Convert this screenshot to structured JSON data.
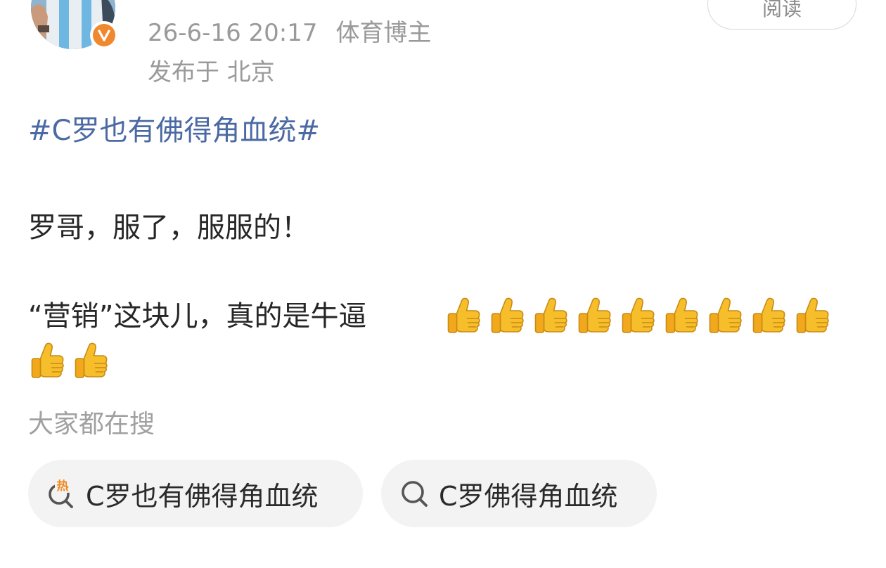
{
  "post_header": {
    "timestamp": "26-6-16 20:17",
    "author_tag": "体育博主",
    "location": "发布于 北京",
    "read_button_label": "阅读",
    "avatar_badge_icon": "verified-v-icon",
    "badge_color": "#f0892e"
  },
  "post_body": {
    "topic_tag": "#C罗也有佛得角血统#",
    "line1": "罗哥，服了，服服的！",
    "line2_text": "“营销”这块儿，真的是牛逼",
    "thumbs_icon": "thumbs-up-icon",
    "thumbs_count": 11,
    "topic_color": "#4b6aa3"
  },
  "search_section": {
    "label": "大家都在搜",
    "chips": [
      {
        "label": "C罗也有佛得角血统",
        "icon": "hot-search-icon"
      },
      {
        "label": "C罗佛得角血统",
        "icon": "search-icon"
      }
    ]
  }
}
